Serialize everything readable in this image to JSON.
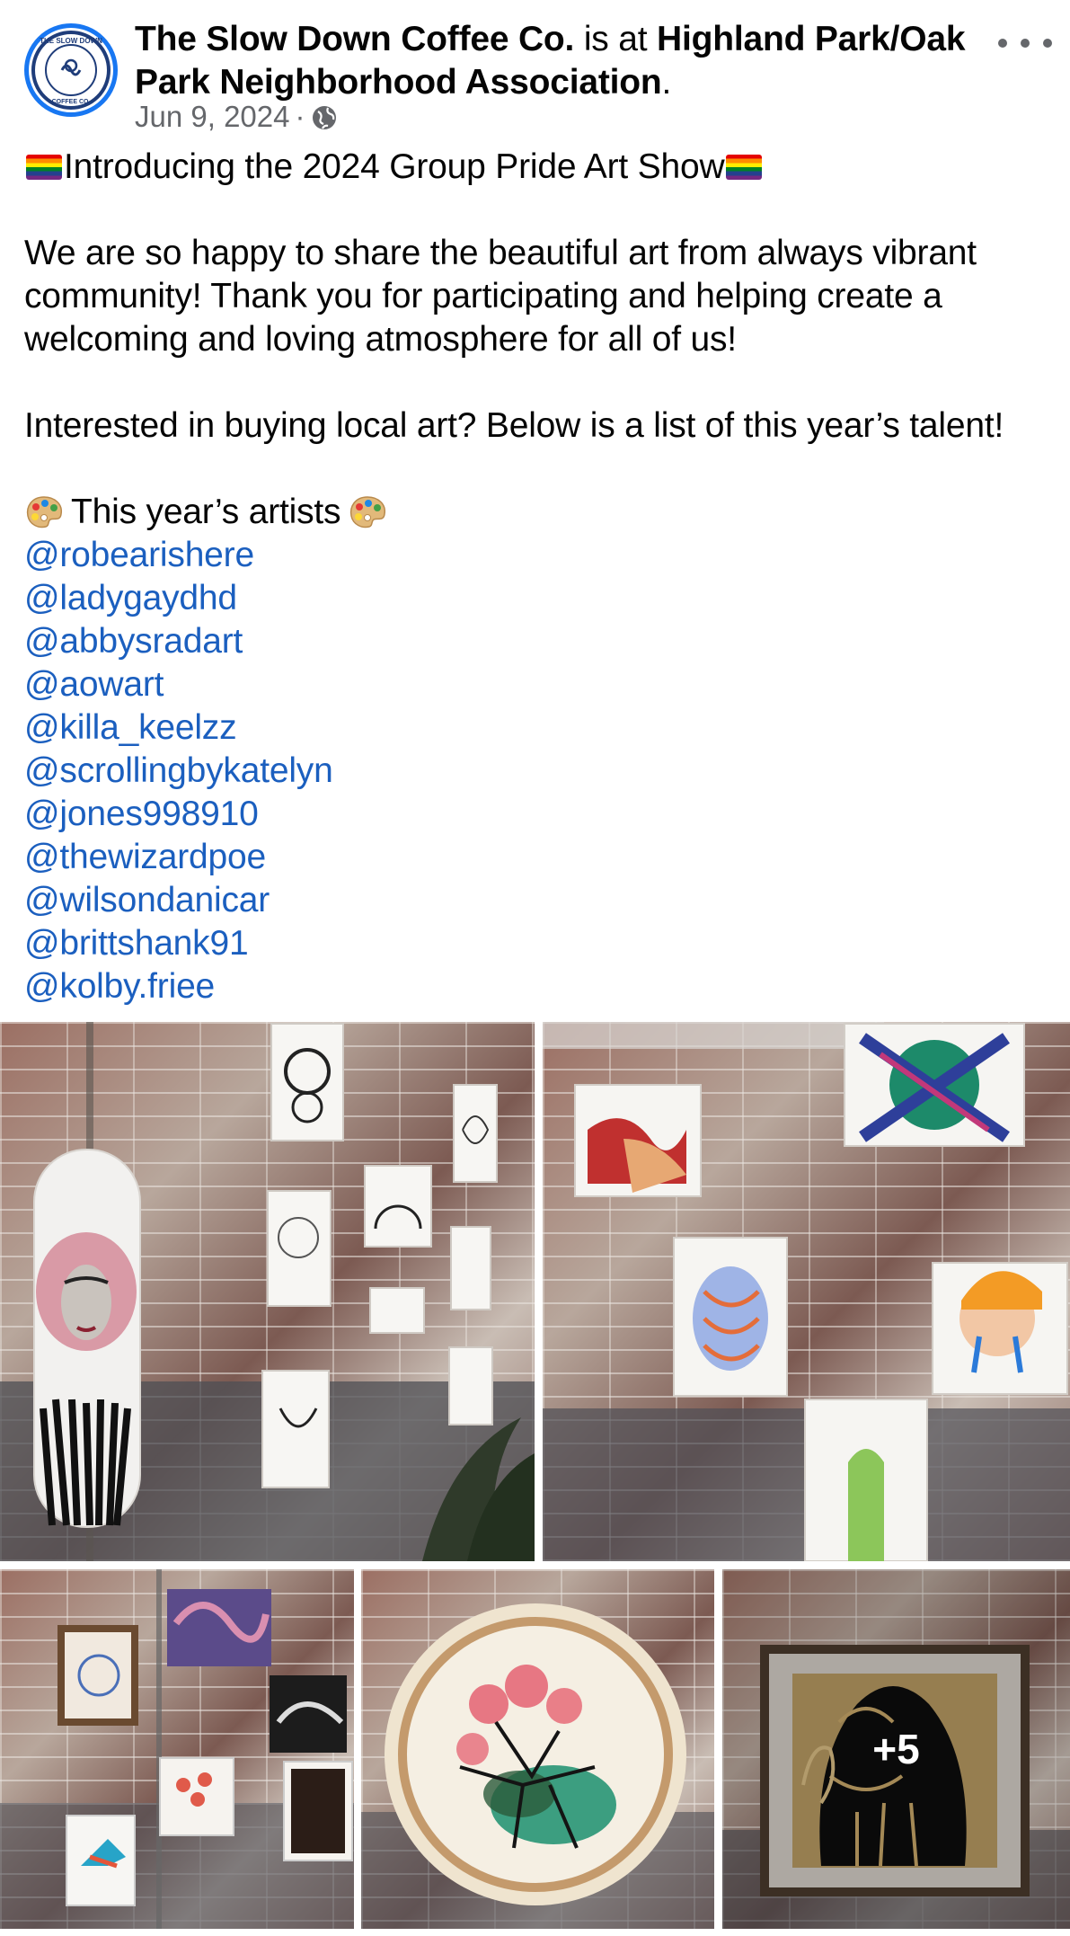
{
  "header": {
    "page_name": "The Slow Down Coffee Co.",
    "is_at": " is at ",
    "location": "Highland Park/Oak Park Neighborhood Association",
    "period": ".",
    "date": "Jun 9, 2024",
    "separator": "·",
    "privacy_icon": "globe-icon",
    "more_icon": "more-options-icon",
    "avatar_icon": "slow-down-coffee-logo",
    "avatar_ring_color": "#1877f2",
    "avatar_logo_text_top": "THE SLOW DOWN",
    "avatar_logo_text_bottom": "COFFEE CO."
  },
  "post": {
    "title": "Introducing the 2024 Group Pride Art Show",
    "title_icon": "rainbow-flag-icon",
    "paragraph1_line1": "We are so happy to share the beautiful art from always vibrant",
    "paragraph1_line2": "community! Thank you for participating and helping create a",
    "paragraph1_line3": "welcoming and loving atmosphere for all of us!",
    "paragraph2": "Interested in buying local art? Below is a list of this year’s talent!",
    "artists_heading": "This year’s artists",
    "artists_icon": "artist-palette-icon",
    "mentions": [
      "@robearishere",
      "@ladygaydhd",
      "@abbysradart",
      "@aowart",
      "@killa_keelzz",
      "@scrollingbykatelyn",
      "@jones998910",
      "@thewizardpoe",
      "@wilsondanicar",
      "@brittshank91",
      "@kolby.friee"
    ],
    "mention_color": "#1b5fbf"
  },
  "photos": {
    "count_overlay": "+5",
    "images": [
      {
        "name": "skateboard-and-drawings-wall"
      },
      {
        "name": "colorful-paintings-wall"
      },
      {
        "name": "framed-art-wall"
      },
      {
        "name": "embroidery-hoop-art"
      },
      {
        "name": "framed-portrait-cutout"
      }
    ]
  }
}
